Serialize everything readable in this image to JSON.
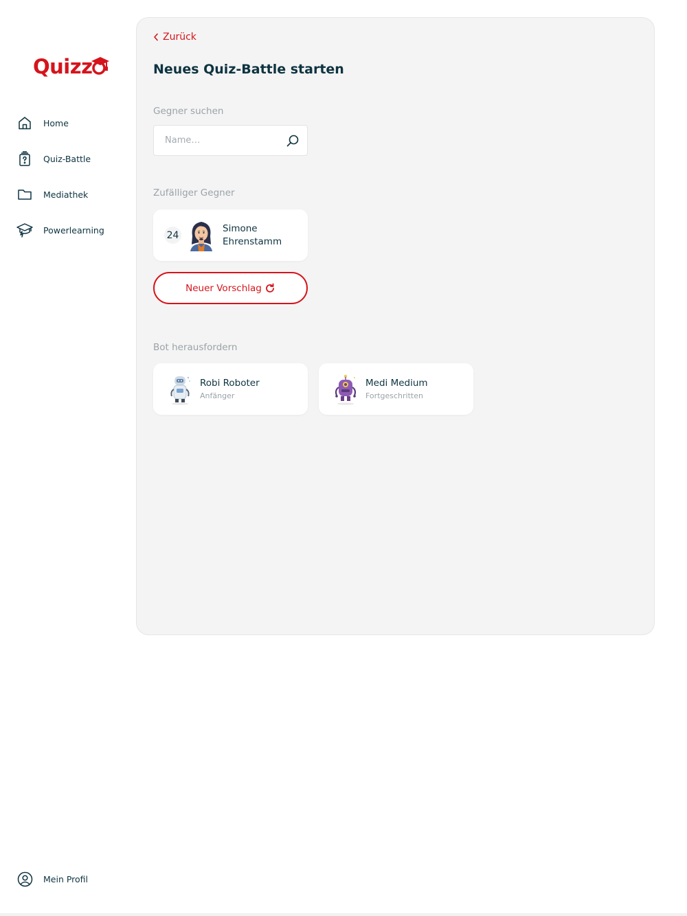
{
  "brand": {
    "logo_text": "Quizz",
    "accent": "#d5141b",
    "text_dark": "#0d3340"
  },
  "sidebar": {
    "items": [
      {
        "label": "Home",
        "icon": "home-icon"
      },
      {
        "label": "Quiz-Battle",
        "icon": "quiz-battle-icon"
      },
      {
        "label": "Mediathek",
        "icon": "folder-icon"
      },
      {
        "label": "Powerlearning",
        "icon": "graduation-cap-icon"
      }
    ],
    "profile": {
      "label": "Mein Profil",
      "icon": "user-circle-icon"
    }
  },
  "main": {
    "back_label": "Zurück",
    "title": "Neues Quiz-Battle starten",
    "search": {
      "label": "Gegner suchen",
      "placeholder": "Name…",
      "value": ""
    },
    "random": {
      "label": "Zufälliger Gegner",
      "opponent": {
        "level": "24",
        "name": "Simone Ehrenstamm"
      },
      "suggest_label": "Neuer Vorschlag"
    },
    "bots": {
      "label": "Bot herausfordern",
      "items": [
        {
          "name": "Robi Roboter",
          "level": "Anfänger"
        },
        {
          "name": "Medi Medium",
          "level": "Fortgeschritten"
        }
      ]
    }
  }
}
